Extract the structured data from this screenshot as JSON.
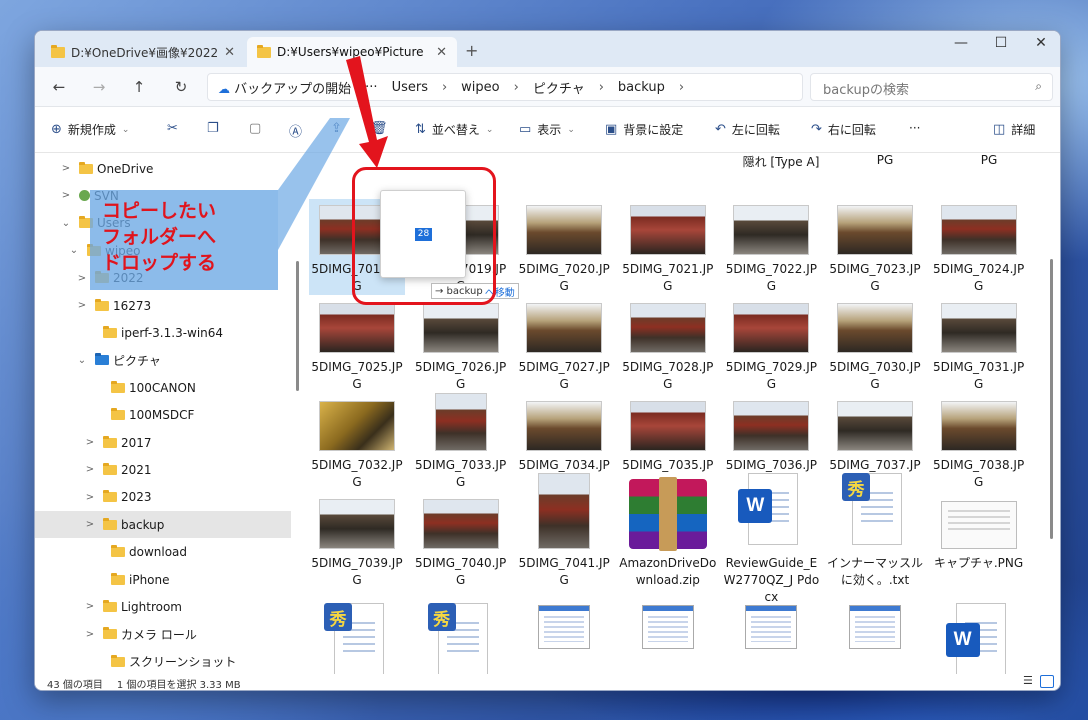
{
  "tabs": [
    {
      "label": "D:¥OneDrive¥画像¥2022¥"
    },
    {
      "label": "D:¥Users¥wipeo¥Picture"
    }
  ],
  "window_controls": {
    "minimize": "—",
    "maximize": "☐",
    "close": "✕"
  },
  "nav": {
    "back": "←",
    "forward": "→",
    "up": "↑",
    "refresh": "↻"
  },
  "address": {
    "backup_status": "バックアップの開始",
    "more": "···",
    "crumbs": [
      "Users",
      "wipeo",
      "ピクチャ",
      "backup"
    ],
    "sep": "›"
  },
  "search": {
    "placeholder": "backupの検索"
  },
  "commands": {
    "new": "新規作成",
    "sort": "並べ替え",
    "view": "表示",
    "set_background": "背景に設定",
    "rotate_left": "左に回転",
    "rotate_right": "右に回転",
    "more": "···",
    "details": "詳細"
  },
  "sidebar": {
    "items": [
      {
        "label": "OneDrive",
        "chev": ">"
      },
      {
        "label": "SVN",
        "chev": ">"
      },
      {
        "label": "Users",
        "chev": "⌄"
      },
      {
        "label": "wipeo",
        "chev": "⌄"
      },
      {
        "label": "2022",
        "chev": ">"
      },
      {
        "label": "16273",
        "chev": ">"
      },
      {
        "label": "iperf-3.1.3-win64",
        "chev": ""
      },
      {
        "label": "ピクチャ",
        "chev": "⌄"
      },
      {
        "label": "100CANON",
        "chev": ""
      },
      {
        "label": "100MSDCF",
        "chev": ""
      },
      {
        "label": "2017",
        "chev": ">"
      },
      {
        "label": "2021",
        "chev": ">"
      },
      {
        "label": "2023",
        "chev": ">"
      },
      {
        "label": "backup",
        "chev": ">"
      },
      {
        "label": "download",
        "chev": ""
      },
      {
        "label": "iPhone",
        "chev": ""
      },
      {
        "label": "Lightroom",
        "chev": ">"
      },
      {
        "label": "カメラ ロール",
        "chev": ">"
      },
      {
        "label": "スクリーンショット",
        "chev": ""
      }
    ]
  },
  "top_labels": [
    "隠れ [Type A]",
    "PG",
    "PG"
  ],
  "files": [
    {
      "name": "5DIMG_7018.JPG"
    },
    {
      "name": "5DIMG_7019.JPG"
    },
    {
      "name": "5DIMG_7020.JPG"
    },
    {
      "name": "5DIMG_7021.JPG"
    },
    {
      "name": "5DIMG_7022.JPG"
    },
    {
      "name": "5DIMG_7023.JPG"
    },
    {
      "name": "5DIMG_7024.JPG"
    },
    {
      "name": "5DIMG_7025.JPG"
    },
    {
      "name": "5DIMG_7026.JPG"
    },
    {
      "name": "5DIMG_7027.JPG"
    },
    {
      "name": "5DIMG_7028.JPG"
    },
    {
      "name": "5DIMG_7029.JPG"
    },
    {
      "name": "5DIMG_7030.JPG"
    },
    {
      "name": "5DIMG_7031.JPG"
    },
    {
      "name": "5DIMG_7032.JPG"
    },
    {
      "name": "5DIMG_7033.JPG"
    },
    {
      "name": "5DIMG_7034.JPG"
    },
    {
      "name": "5DIMG_7035.JPG"
    },
    {
      "name": "5DIMG_7036.JPG"
    },
    {
      "name": "5DIMG_7037.JPG"
    },
    {
      "name": "5DIMG_7038.JPG"
    },
    {
      "name": "5DIMG_7039.JPG"
    },
    {
      "name": "5DIMG_7040.JPG"
    },
    {
      "name": "5DIMG_7041.JPG"
    },
    {
      "name": "AmazonDriveDownload.zip"
    },
    {
      "name": "ReviewGuide_EW2770QZ_J Pdocx"
    },
    {
      "name": "インナーマッスルに効く。.txt"
    },
    {
      "name": "キャプチャ.PNG"
    }
  ],
  "drag": {
    "count": "28",
    "hint_arrow": "→ backup",
    "hint_action": "へ移動"
  },
  "status": {
    "items": "43 個の項目",
    "selected": "1 個の項目を選択  3.33 MB"
  },
  "annotation": {
    "line1": "コピーしたい",
    "line2": "フォルダーへ",
    "line3": "ドロップする"
  },
  "colors": {
    "accent": "#1e6fd9",
    "annotation_red": "#e3141d",
    "callout_bg": "#6ca8e4"
  }
}
